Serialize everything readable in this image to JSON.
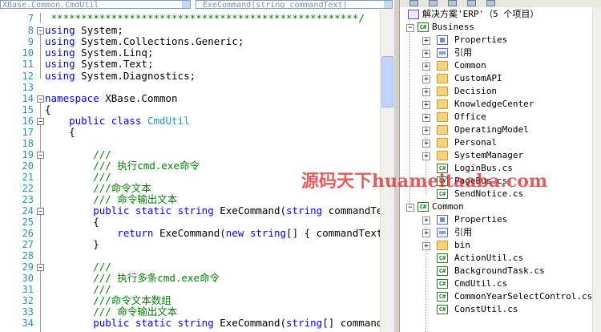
{
  "editor": {
    "class_combo": "XBase.Common.CmdUtil",
    "member_combo": "ExeCommand(string commandText)",
    "line_numbers": [
      "7",
      "8",
      "9",
      "10",
      "11",
      "12",
      "13",
      "14",
      "15",
      "16",
      "17",
      "18",
      "19",
      "20",
      "21",
      "22",
      "23",
      "24",
      "25",
      "26",
      "27",
      "28",
      "29",
      "30",
      "31",
      "32",
      "33",
      "34"
    ],
    "lines": {
      "l7": " ***************************************************/",
      "l8_kw": "using",
      "l8": " System;",
      "l9_kw": "using",
      "l9": " System.Collections.Generic;",
      "l10_kw": "using",
      "l10": " System.Linq;",
      "l11_kw": "using",
      "l11": " System.Text;",
      "l12_kw": "using",
      "l12": " System.Diagnostics;",
      "l14_kw": "namespace",
      "l14": " XBase.Common",
      "l15": "{",
      "l16_kw": "    public class",
      "l16_ty": " CmdUtil",
      "l17": "    {",
      "l19": "        ///",
      "l20": "        /// 执行cmd.exe命令",
      "l21": "        ///",
      "l22": "        ///命令文本",
      "l23": "        /// 命令输出文本",
      "l24_kw": "        public static string",
      "l24": " ExeCommand(",
      "l24_kw2": "string",
      "l24b": " commandText)",
      "l25": "        {",
      "l26_kw": "            return",
      "l26": " ExeCommand(",
      "l26_kw2": "new string",
      "l26b": "[] { commandText })",
      "l27": "        }",
      "l29": "        ///",
      "l30": "        /// 执行多条cmd.exe命令",
      "l31": "        ///",
      "l32": "        ///命令文本数组",
      "l33": "        /// 命令输出文本",
      "l34_kw": "        public static string",
      "l34": " ExeCommand(",
      "l34_kw2": "string",
      "l34b": "[] commandTex"
    }
  },
  "solution_explorer": {
    "solution_label": "解决方案'ERP'（5 个项目）",
    "items": [
      {
        "label": "Business"
      },
      {
        "label": "Properties"
      },
      {
        "label": "引用"
      },
      {
        "label": "Common"
      },
      {
        "label": "CustomAPI"
      },
      {
        "label": "Decision"
      },
      {
        "label": "KnowledgeCenter"
      },
      {
        "label": "Office"
      },
      {
        "label": "OperatingModel"
      },
      {
        "label": "Personal"
      },
      {
        "label": "SystemManager"
      },
      {
        "label": "LoginBus.cs"
      },
      {
        "label": "PageBus.cs"
      },
      {
        "label": "SendNotice.cs"
      },
      {
        "label": "Common"
      },
      {
        "label": "Properties"
      },
      {
        "label": "引用"
      },
      {
        "label": "bin"
      },
      {
        "label": "ActionUtil.cs"
      },
      {
        "label": "BackgroundTask.cs"
      },
      {
        "label": "CmdUtil.cs"
      },
      {
        "label": "CommonYearSelectControl.cs"
      },
      {
        "label": "ConstUtil.cs"
      }
    ],
    "expander_collapsed": "+",
    "expander_expanded": "−",
    "cs_icon_text": "C#"
  },
  "watermark": "源码天下huameitaaba.com",
  "colors": {
    "keyword": "#0000ff",
    "comment": "#008000",
    "type": "#2b91af",
    "line_number": "#2b91af",
    "watermark": "#d72828"
  }
}
